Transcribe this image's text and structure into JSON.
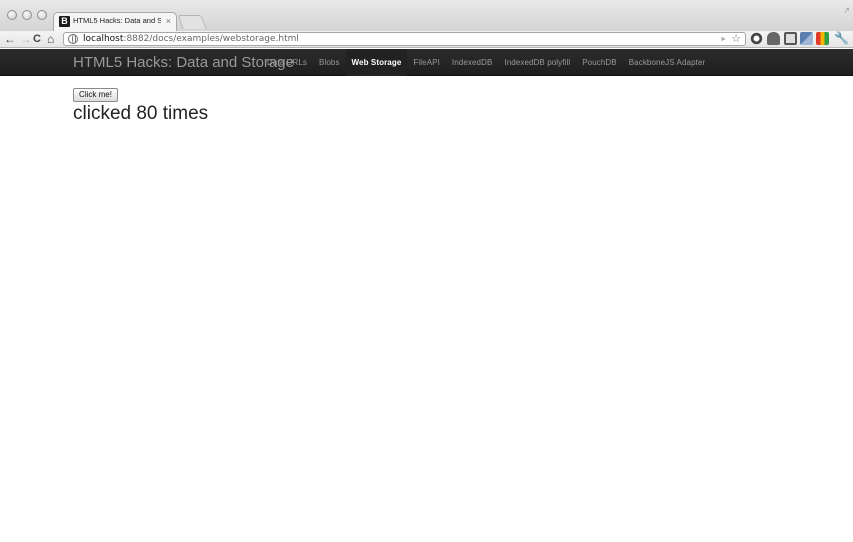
{
  "browser": {
    "tab": {
      "favicon_letter": "B",
      "title": "HTML5 Hacks: Data and Sto",
      "close_glyph": "×"
    },
    "url": {
      "host": "localhost",
      "rest": ":8882/docs/examples/webstorage.html"
    }
  },
  "navbar": {
    "brand": "HTML5 Hacks: Data and Storage",
    "items": [
      {
        "label": "Data URLs"
      },
      {
        "label": "Blobs"
      },
      {
        "label": "Web Storage"
      },
      {
        "label": "FileAPI"
      },
      {
        "label": "IndexedDB"
      },
      {
        "label": "IndexedDB polyfill"
      },
      {
        "label": "PouchDB"
      },
      {
        "label": "BackboneJS Adapter"
      }
    ],
    "active_index": 2
  },
  "main": {
    "button_label": "Click me!",
    "counter_text": "clicked 80 times"
  }
}
